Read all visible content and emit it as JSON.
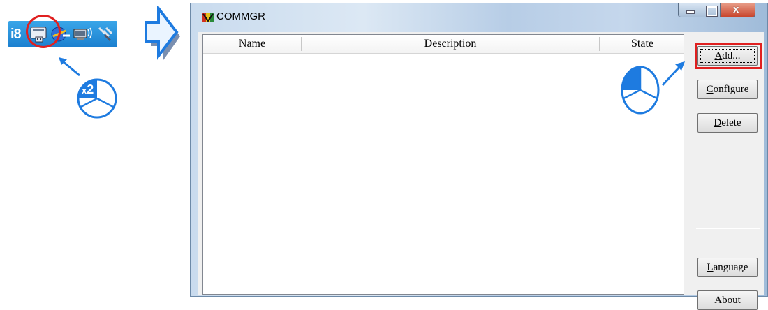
{
  "tray": {
    "text": "i8",
    "click_hint_prefix": "x",
    "click_hint_count": "2"
  },
  "window": {
    "title": "COMMGR",
    "close_glyph": "x"
  },
  "list": {
    "columns": [
      "Name",
      "Description",
      "State"
    ],
    "rows": []
  },
  "buttons": {
    "add": "Add...",
    "configure": "Configure",
    "delete": "Delete",
    "language": "Language",
    "about": "About"
  },
  "colors": {
    "highlight": "#e02020",
    "callout_blue": "#1e7be0",
    "taskbar": "#1b7fcf"
  },
  "icons": [
    "commgr-icon",
    "network-icon",
    "monitor-icon",
    "satellite-icon",
    "mouse-icon",
    "arrow-right-icon"
  ]
}
